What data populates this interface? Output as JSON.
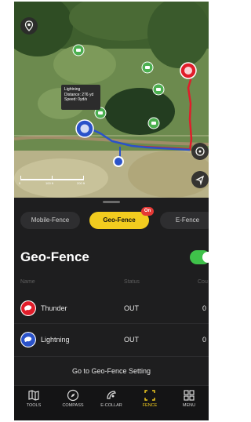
{
  "map": {
    "tooltip": {
      "name": "Lightning",
      "distance": "Distance: 276 yd",
      "speed": "Speed: 0yd/s"
    },
    "scale_labels": [
      "0",
      "100 ft",
      "200 ft"
    ],
    "colors": {
      "track_red": "#e11d2a",
      "track_blue": "#2a52c9",
      "marker_green": "#4caf50"
    },
    "icons": [
      "location-pin-icon",
      "recenter-icon",
      "navigate-icon"
    ]
  },
  "segment": {
    "items": [
      "Mobile-Fence",
      "Geo-Fence",
      "E-Fence"
    ],
    "active": "Geo-Fence",
    "badge": "On"
  },
  "geofence": {
    "title": "Geo-Fence",
    "enabled": true,
    "columns": [
      "Name",
      "Status",
      "Cou"
    ],
    "rows": [
      {
        "name": "Thunder",
        "status": "OUT",
        "count": "0",
        "color": "#e11d2a"
      },
      {
        "name": "Lightning",
        "status": "OUT",
        "count": "0",
        "color": "#2a52c9"
      }
    ],
    "settings_link": "Go to Geo-Fence Setting"
  },
  "tabbar": {
    "items": [
      {
        "label": "TOOLS",
        "icon": "map-icon"
      },
      {
        "label": "COMPASS",
        "icon": "compass-icon"
      },
      {
        "label": "E-COLLAR",
        "icon": "e-collar-icon"
      },
      {
        "label": "FENCE",
        "icon": "fence-icon"
      },
      {
        "label": "MENU",
        "icon": "menu-grid-icon"
      }
    ],
    "active": "FENCE",
    "active_color": "#f2cc1f"
  }
}
